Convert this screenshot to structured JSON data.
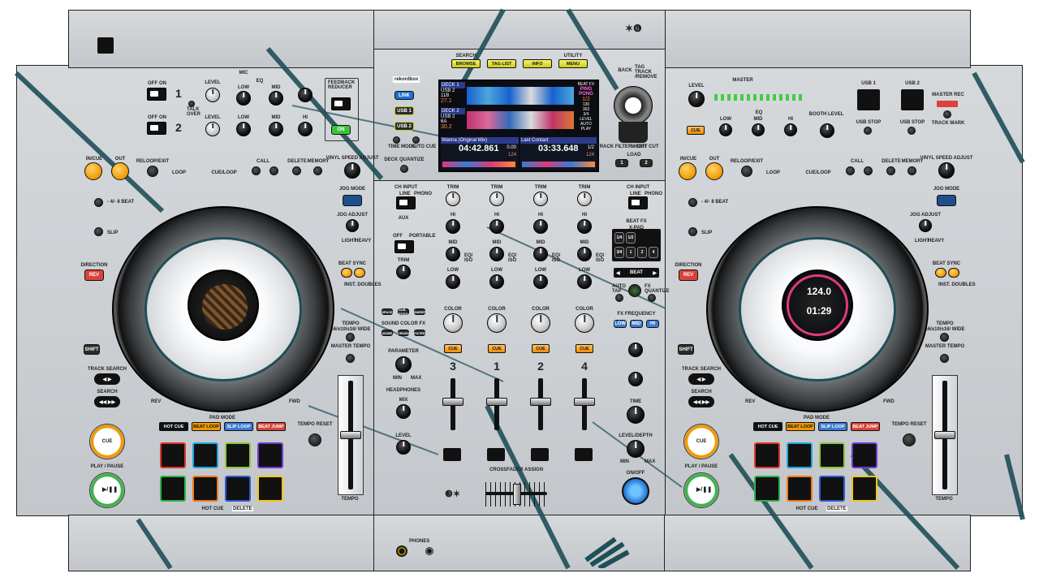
{
  "colors": {
    "body": "#c9cdd1",
    "teal": "#1f4f57",
    "orange": "#f09a00",
    "yellow": "#e8ec2a",
    "screen": "#0b0d12"
  },
  "top": {
    "search": "SEARCH",
    "utility": "UTILITY",
    "buttons": [
      "BROWSE",
      "TAG LIST",
      "INFO",
      "MENU"
    ],
    "rekordbox": "rekordbox",
    "link": "LINK",
    "usb1": "USB 1",
    "usb2": "USB 2",
    "time_mode": "TIME MODE",
    "auto_cue": "AUTO CUE",
    "deck_quantize": "DECK QUANTIZE",
    "back": "BACK",
    "tag_track": "TAG TRACK /REMOVE",
    "track_filter": "TRACK FILTER / EDIT",
    "short_cut": "SHORT CUT",
    "load": "LOAD",
    "load_1": "1",
    "load_2": "2"
  },
  "screen": {
    "deck1": {
      "label": "DECK 1",
      "src": "USB 2",
      "num": "11B",
      "bpm": "27.1"
    },
    "deck2": {
      "label": "DECK 2",
      "src": "USB 2",
      "num": "6A",
      "bpm": "30.2"
    },
    "beatfx": "BEAT FX",
    "fx_name": "PING PONG",
    "fx_val": "1/2",
    "track1": {
      "title": "Wanna (Original Mix)",
      "time": "04:42.861",
      "pitch": "0.00",
      "bpm": "124"
    },
    "track2": {
      "title": "Last Contact",
      "time": "03:33.648",
      "pitch": "1/2",
      "bpm": "124"
    },
    "side": [
      "130",
      "363",
      "3/4",
      "LEVEL",
      "AUTO PLAY"
    ]
  },
  "mic": {
    "title": "MIC",
    "talk_over": "TALK OVER",
    "level": "LEVEL",
    "low": "LOW",
    "mid": "MID",
    "hi": "HI",
    "eq": "EQ",
    "off": "OFF",
    "on": "ON",
    "ch1": "1",
    "ch2": "2",
    "feedback": "FEEDBACK REDUCER",
    "light": "LIGHT",
    "heavy": "HEAVY",
    "on_btn": "ON"
  },
  "master": {
    "title": "MASTER",
    "level": "LEVEL",
    "eq": "EQ",
    "low": "LOW",
    "mid": "MID",
    "hi": "HI",
    "cue": "CUE",
    "usb1": "USB 1",
    "usb2": "USB 2",
    "usb_stop": "USB STOP",
    "master_rec": "MASTER REC",
    "track_mark": "TRACK MARK",
    "booth": "BOOTH LEVEL"
  },
  "left": {
    "in": "IN/CUE",
    "out": "OUT",
    "reloop": "RELOOP/EXIT",
    "loop": "LOOP",
    "cue_loop": "CUE/LOOP",
    "call": "CALL",
    "delete": "DELETE",
    "memory": "MEMORY",
    "vinyl": "VINYL SPEED ADJUST",
    "beat_4": "- 4/- 8 BEAT",
    "slip": "SLIP",
    "direction": "DIRECTION",
    "rev": "REV",
    "jog_mode": "JOG MODE",
    "jog_adjust": "JOG ADJUST",
    "light": "LIGHT",
    "heavy": "HEAVY",
    "beat_sync": "BEAT SYNC",
    "inst_doubles": "INST. DOUBLES",
    "tempo": "TEMPO",
    "tempo_range": "±6/±10/±16/ WIDE",
    "master_tempo": "MASTER TEMPO",
    "shift": "SHIFT",
    "track_search": "TRACK SEARCH",
    "search": "SEARCH",
    "rev_s": "REV",
    "fwd": "FWD",
    "cue": "CUE",
    "play": "PLAY / PAUSE",
    "tempo_reset": "TEMPO RESET",
    "tempo_label": "TEMPO",
    "pad_mode": "PAD MODE",
    "hot_cue_del": "HOT CUE",
    "mode": "MODE"
  },
  "pad_modes": [
    {
      "label": "HOT CUE",
      "bg": "#111",
      "fg": "#fff"
    },
    {
      "label": "BEAT LOOP",
      "bg": "#f09a00",
      "fg": "#111"
    },
    {
      "label": "SLIP LOOP",
      "bg": "#3a7bd5",
      "fg": "#fff"
    },
    {
      "label": "BEAT JUMP",
      "bg": "#d9433a",
      "fg": "#fff"
    }
  ],
  "pad_colors": [
    "#e0352b",
    "#1fa7e0",
    "#8dc63f",
    "#6e3bd1",
    "#2fb34a",
    "#f07a1a",
    "#2f5bd1",
    "#f5c518"
  ],
  "right_deck": {
    "bpm": "124.0",
    "time": "01:29"
  },
  "mixer": {
    "ch_input": "CH INPUT",
    "line": "LINE",
    "phono": "PHONO",
    "usb": "USB",
    "aux": "AUX",
    "off": "OFF",
    "portable": "PORTABLE",
    "trim": "TRIM",
    "hi": "HI",
    "eq": "EQ/ ISO",
    "mid": "MID",
    "low": "LOW",
    "color": "COLOR",
    "cue": "CUE",
    "sound_color": "SOUND COLOR FX",
    "space": "SPACE",
    "dub_echo": "DUB ECHO",
    "sweep": "SWEEP",
    "noise": "NOISE",
    "crush": "CRUSH",
    "filter": "FILTER",
    "parameter": "PARAMETER",
    "min": "MIN",
    "max": "MAX",
    "headphones": "HEADPHONES",
    "mix": "MIX",
    "level": "LEVEL",
    "master": "MASTER",
    "channels": [
      "3",
      "1",
      "2",
      "4"
    ],
    "xfader_assign": "CROSSFADER ASSIGN",
    "phones": "PHONES",
    "beat_fx": "BEAT FX",
    "x_pad": "X-PAD",
    "xpad": [
      "1/4",
      "1/2",
      "3/4",
      "1",
      "2",
      "4"
    ],
    "beat": "BEAT",
    "auto_tap": "AUTO TAP",
    "fx_quant": "FX QUANTIZE",
    "fx_freq": "FX FREQUENCY",
    "lo": "LOW",
    "md": "MID",
    "hi_b": "HI",
    "time": "TIME",
    "level_depth": "LEVEL/DEPTH",
    "on_off": "ON/OFF"
  }
}
